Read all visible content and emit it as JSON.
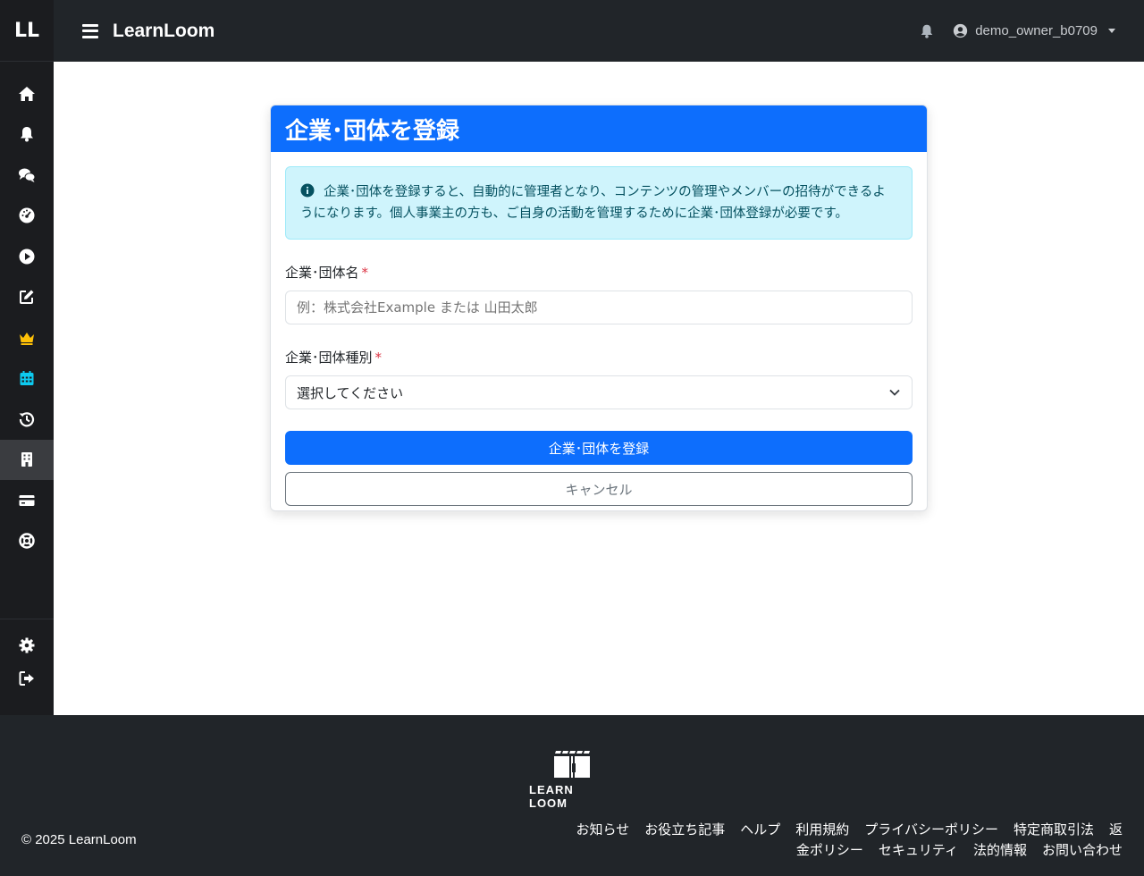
{
  "sidebar": {
    "logo": "LL",
    "nav_icons": [
      "home-icon",
      "bell-icon",
      "comments-icon",
      "dashboard-icon",
      "play-icon",
      "edit-icon",
      "crown-icon",
      "calendar-icon",
      "history-icon",
      "building-icon",
      "credit-card-icon",
      "lifebuoy-icon"
    ],
    "active": "building-icon",
    "bottom_icons": [
      "gear-icon",
      "logout-icon"
    ]
  },
  "header": {
    "brand": "LearnLoom",
    "username": "demo_owner_b0709"
  },
  "card": {
    "title": "企業･団体を登録",
    "alert_text": "企業･団体を登録すると、自動的に管理者となり、コンテンツの管理やメンバーの招待ができるようになります。個人事業主の方も、ご自身の活動を管理するために企業･団体登録が必要です。",
    "name_label": "企業･団体名",
    "name_placeholder": "例：株式会社Example または 山田太郎",
    "type_label": "企業･団体種別",
    "type_selected": "選択してください",
    "required_mark": "*",
    "submit_label": "企業･団体を登録",
    "cancel_label": "キャンセル"
  },
  "footer": {
    "logo_text": "LEARN LOOM",
    "copyright": "© 2025 LearnLoom",
    "links": [
      "お知らせ",
      "お役立ち記事",
      "ヘルプ",
      "利用規約",
      "プライバシーポリシー",
      "特定商取引法",
      "返金ポリシー",
      "セキュリティ",
      "法的情報",
      "お問い合わせ"
    ]
  },
  "colors": {
    "primary": "#0d6efd",
    "header_bg": "#212529",
    "sidebar_bg": "#1b1c1f",
    "crown": "#ffc107",
    "calendar": "#0dcaf0"
  }
}
